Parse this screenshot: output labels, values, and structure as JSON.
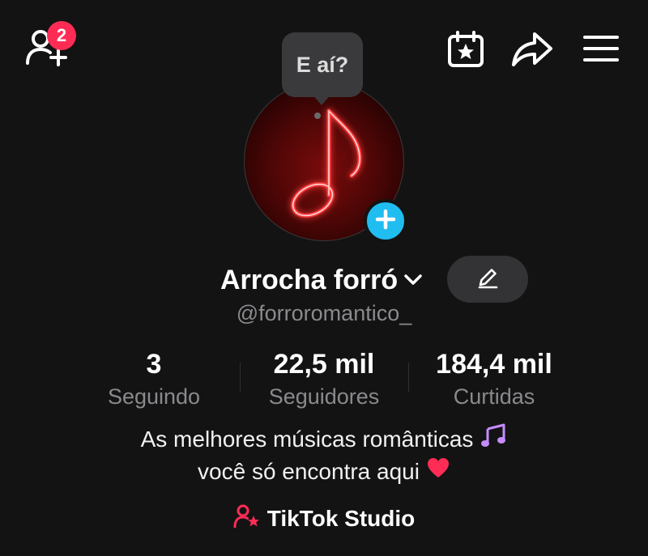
{
  "header": {
    "notifications_count": "2",
    "icons": [
      "add-friend-icon",
      "calendar-star-icon",
      "share-icon",
      "menu-icon"
    ]
  },
  "avatar": {
    "tooltip": "E aí?",
    "image": "red neon music note"
  },
  "profile": {
    "display_name": "Arrocha forró",
    "username": "@forroromantico_"
  },
  "stats": [
    {
      "value": "3",
      "label": "Seguindo"
    },
    {
      "value": "22,5 mil",
      "label": "Seguidores"
    },
    {
      "value": "184,4 mil",
      "label": "Curtidas"
    }
  ],
  "bio": {
    "line1": "As melhores músicas românticas",
    "line2": "você só encontra aqui"
  },
  "studio": {
    "label": "TikTok Studio"
  },
  "colors": {
    "background": "#131313",
    "badge": "#fe2c55",
    "add_button": "#20bdf0",
    "muted_text": "#8a8a8e"
  }
}
